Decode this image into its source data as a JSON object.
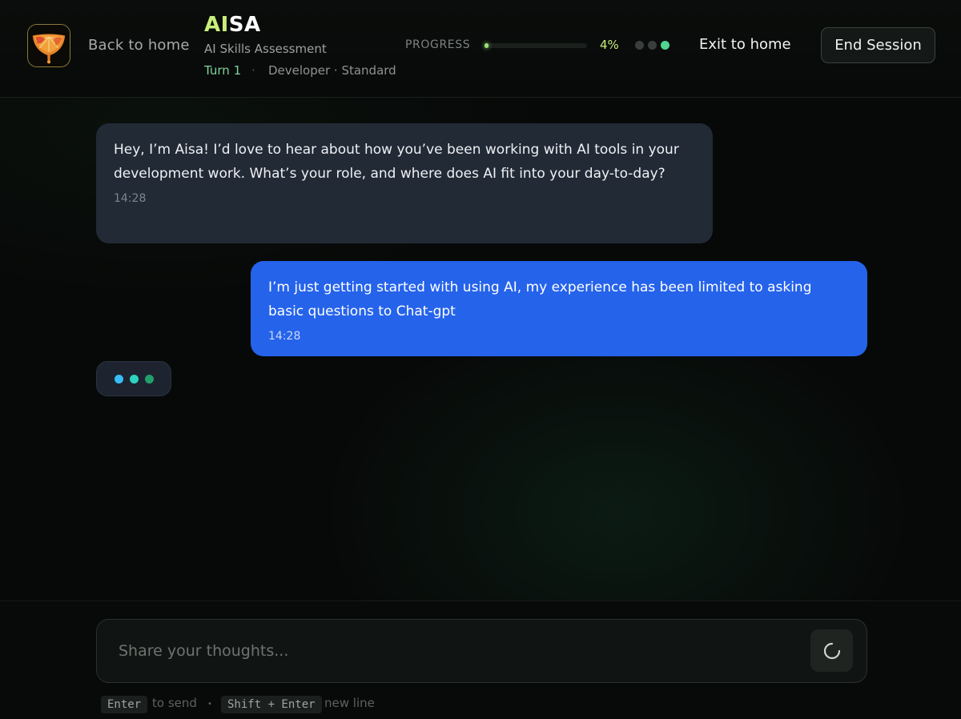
{
  "header": {
    "back_label": "Back to home",
    "brand_ai": "AI",
    "brand_sa": "SA",
    "subtitle": "AI Skills Assessment",
    "turn": "Turn 1",
    "separator": "·",
    "meta": "Developer · Standard",
    "progress_label": "PROGRESS",
    "progress_value": 0.04,
    "progress_text": "4%",
    "stages": [
      {
        "state": "inactive"
      },
      {
        "state": "inactive"
      },
      {
        "state": "active"
      }
    ],
    "exit_label": "Exit to home",
    "end_label": "End Session"
  },
  "messages": [
    {
      "role": "assistant",
      "text": "Hey, I’m Aisa! I’d love to hear about how you’ve been working with AI tools in your development work. What’s your role, and where does AI fit into your day-to-day?",
      "time": "14:28"
    },
    {
      "role": "user",
      "text": "I’m just getting started with using AI, my experience has been limited to asking basic questions to Chat-gpt",
      "time": "14:28"
    }
  ],
  "composer": {
    "placeholder": "Share your thoughts...",
    "value": ""
  },
  "hints": {
    "send_key": "Enter",
    "send_text": "to send",
    "bullet": "•",
    "newline_key": "Shift + Enter",
    "newline_text": "new line"
  },
  "colors": {
    "accent_lime": "#c8ef7a",
    "turn_green": "#7fd39c",
    "user_bubble": "#2563eb",
    "assistant_bubble": "#222a36",
    "typing_dots": [
      "#38bdf8",
      "#2dd4bf",
      "#22a06b"
    ]
  },
  "icons": {
    "logo": "citrus-slice-logo",
    "send": "loading-spinner-icon"
  }
}
